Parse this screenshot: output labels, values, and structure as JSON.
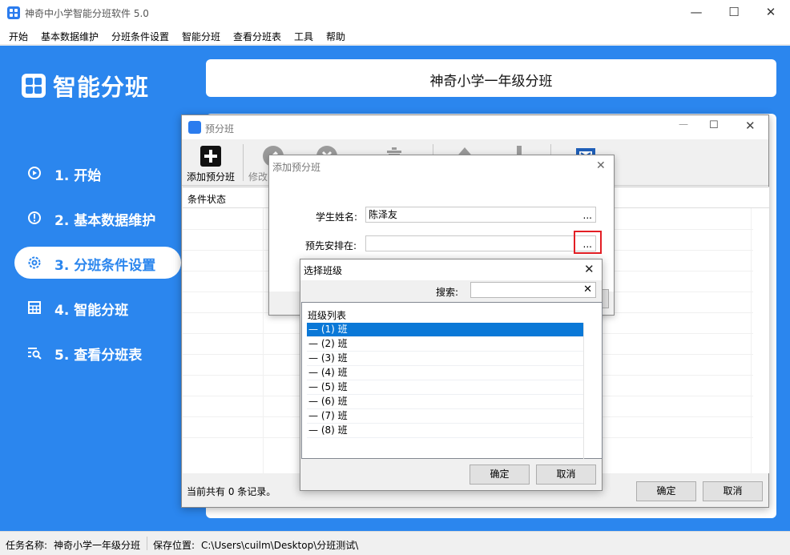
{
  "window": {
    "title": "神奇中小学智能分班软件 5.0",
    "minimize": "—",
    "maximize": "☐",
    "close": "✕"
  },
  "menu": [
    "开始",
    "基本数据维护",
    "分班条件设置",
    "智能分班",
    "查看分班表",
    "工具",
    "帮助"
  ],
  "sidebar": {
    "logo_text": "智能分班",
    "items": [
      {
        "label": "1. 开始",
        "icon": "play-circle-icon",
        "active": false
      },
      {
        "label": "2. 基本数据维护",
        "icon": "info-circle-icon",
        "active": false
      },
      {
        "label": "3. 分班条件设置",
        "icon": "gear-icon",
        "active": true
      },
      {
        "label": "4. 智能分班",
        "icon": "table-icon",
        "active": false
      },
      {
        "label": "5. 查看分班表",
        "icon": "search-list-icon",
        "active": false
      }
    ]
  },
  "banner": {
    "title": "神奇小学一年级分班"
  },
  "statusbar": {
    "task_label": "任务名称:",
    "task_value": "神奇小学一年级分班",
    "save_label": "保存位置:",
    "save_value": "C:\\Users\\cuilm\\Desktop\\分班测试\\"
  },
  "pre_window": {
    "title": "预分班",
    "toolbar": {
      "add_label": "添加预分班",
      "edit_label": "修改"
    },
    "column_header": "条件状态",
    "record_count": "当前共有 0 条记录。",
    "ok": "确定",
    "cancel": "取消"
  },
  "add_dialog": {
    "title": "添加预分班",
    "close": "✕",
    "student_label": "学生姓名:",
    "student_value": "陈泽友",
    "arrange_label": "预先安排在:",
    "arrange_value": "",
    "browse": "..."
  },
  "select_dialog": {
    "title": "选择班级",
    "close": "✕",
    "search_label": "搜索:",
    "search_clear": "✕",
    "list_header": "班级列表",
    "classes": [
      "— (1) 班",
      "— (2) 班",
      "— (3) 班",
      "— (4) 班",
      "— (5) 班",
      "— (6) 班",
      "— (7) 班",
      "— (8) 班"
    ],
    "selected_index": 0,
    "ok": "确定",
    "cancel": "取消"
  },
  "colors": {
    "accent": "#2b86ee",
    "selection": "#0a78d7",
    "highlight_border": "#e31e24"
  }
}
